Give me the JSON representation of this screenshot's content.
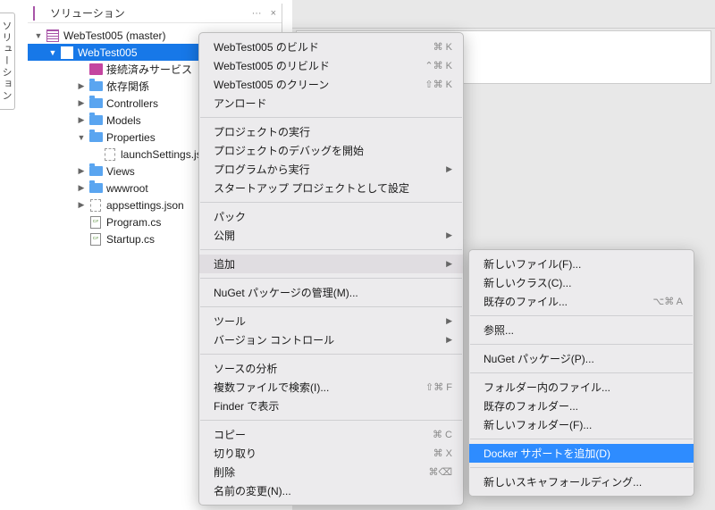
{
  "sidebar_tab": "ソリューション",
  "panel": {
    "title": "ソリューション",
    "dots_label": "···",
    "close_label": "×"
  },
  "tree": {
    "solution": "WebTest005 (master)",
    "project": "WebTest005",
    "items": [
      {
        "label": "接続済みサービス",
        "icon": "folder-pink",
        "indent": 3,
        "arrow": ""
      },
      {
        "label": "依存関係",
        "icon": "folder",
        "indent": 3,
        "arrow": "▶"
      },
      {
        "label": "Controllers",
        "icon": "folder",
        "indent": 3,
        "arrow": "▶"
      },
      {
        "label": "Models",
        "icon": "folder",
        "indent": 3,
        "arrow": "▶"
      },
      {
        "label": "Properties",
        "icon": "folder",
        "indent": 3,
        "arrow": "▼"
      },
      {
        "label": "launchSettings.json",
        "icon": "file",
        "indent": 4,
        "arrow": ""
      },
      {
        "label": "Views",
        "icon": "folder",
        "indent": 3,
        "arrow": "▶"
      },
      {
        "label": "wwwroot",
        "icon": "folder",
        "indent": 3,
        "arrow": "▶"
      },
      {
        "label": "appsettings.json",
        "icon": "file",
        "indent": 3,
        "arrow": "▶"
      },
      {
        "label": "Program.cs",
        "icon": "cs",
        "indent": 3,
        "arrow": ""
      },
      {
        "label": "Startup.cs",
        "icon": "cs",
        "indent": 3,
        "arrow": ""
      }
    ]
  },
  "menu1": [
    {
      "label": "WebTest005 のビルド",
      "shortcut": "⌘ K"
    },
    {
      "label": "WebTest005 のリビルド",
      "shortcut": "⌃⌘ K"
    },
    {
      "label": "WebTest005 のクリーン",
      "shortcut": "⇧⌘ K"
    },
    {
      "label": "アンロード"
    },
    {
      "sep": true
    },
    {
      "label": "プロジェクトの実行"
    },
    {
      "label": "プロジェクトのデバッグを開始"
    },
    {
      "label": "プログラムから実行",
      "sub": "▶"
    },
    {
      "label": "スタートアップ プロジェクトとして設定"
    },
    {
      "sep": true
    },
    {
      "label": "パック"
    },
    {
      "label": "公開",
      "sub": "▶"
    },
    {
      "sep": true
    },
    {
      "label": "追加",
      "sub": "▶",
      "hl": true
    },
    {
      "sep": true
    },
    {
      "label": "NuGet パッケージの管理(M)..."
    },
    {
      "sep": true
    },
    {
      "label": "ツール",
      "sub": "▶"
    },
    {
      "label": "バージョン コントロール",
      "sub": "▶"
    },
    {
      "sep": true
    },
    {
      "label": "ソースの分析"
    },
    {
      "label": "複数ファイルで検索(I)...",
      "shortcut": "⇧⌘ F"
    },
    {
      "label": "Finder で表示"
    },
    {
      "sep": true
    },
    {
      "label": "コピー",
      "shortcut": "⌘ C"
    },
    {
      "label": "切り取り",
      "shortcut": "⌘ X"
    },
    {
      "label": "削除",
      "shortcut": "⌘⌫"
    },
    {
      "label": "名前の変更(N)..."
    }
  ],
  "menu2": [
    {
      "label": "新しいファイル(F)..."
    },
    {
      "label": "新しいクラス(C)..."
    },
    {
      "label": "既存のファイル...",
      "shortcut": "⌥⌘ A"
    },
    {
      "sep": true
    },
    {
      "label": "参照..."
    },
    {
      "sep": true
    },
    {
      "label": "NuGet パッケージ(P)..."
    },
    {
      "sep": true
    },
    {
      "label": "フォルダー内のファイル..."
    },
    {
      "label": "既存のフォルダー..."
    },
    {
      "label": "新しいフォルダー(F)..."
    },
    {
      "sep": true
    },
    {
      "label": "Docker サポートを追加(D)",
      "selected": true
    },
    {
      "sep": true
    },
    {
      "label": "新しいスキャフォールディング..."
    }
  ]
}
